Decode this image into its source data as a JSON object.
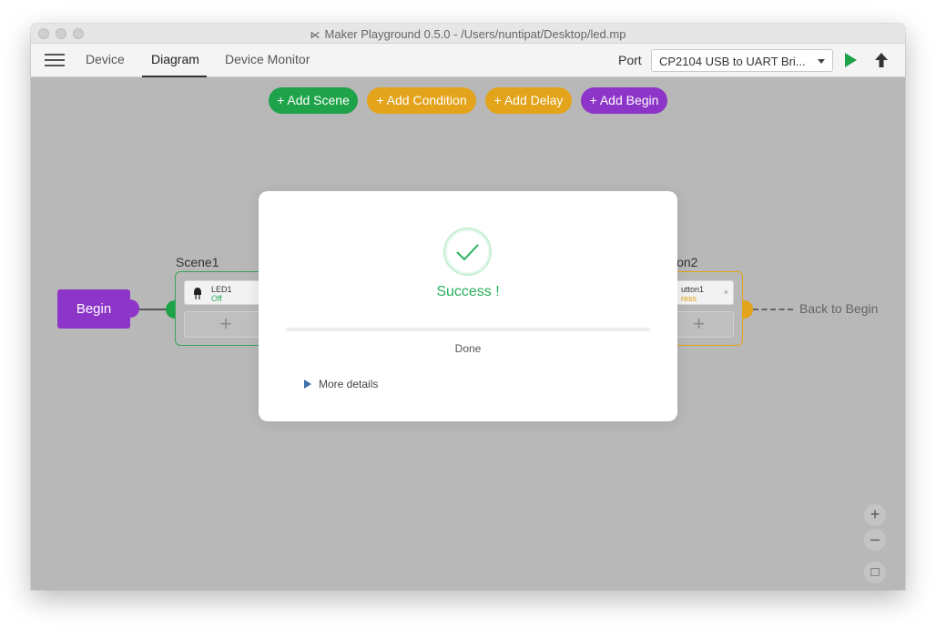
{
  "window": {
    "title": "Maker Playground 0.5.0 - /Users/nuntipat/Desktop/led.mp"
  },
  "toolbar": {
    "tabs": [
      {
        "label": "Device"
      },
      {
        "label": "Diagram",
        "active": true
      },
      {
        "label": "Device Monitor"
      }
    ],
    "port_label": "Port",
    "port_value": "CP2104 USB to UART Bri..."
  },
  "canvas": {
    "add_buttons": [
      {
        "label": "+ Add Scene",
        "color": "#1fa34a"
      },
      {
        "label": "+ Add Condition",
        "color": "#e3a31a"
      },
      {
        "label": "+ Add Delay",
        "color": "#e3a31a"
      },
      {
        "label": "+ Add Begin",
        "color": "#8d35c8"
      }
    ],
    "begin_label": "Begin",
    "scene": {
      "title": "Scene1",
      "device_name": "LED1",
      "device_status": "Off",
      "add_symbol": "+"
    },
    "condition": {
      "title": "ion2",
      "device_name": "utton1",
      "device_status": "ress",
      "close_symbol": "×",
      "add_symbol": "+"
    },
    "back_to_begin": "Back to Begin",
    "zoom": {
      "in": "+",
      "out": "–",
      "fit": "□"
    }
  },
  "dialog": {
    "title": "Success !",
    "progress_status": "Done",
    "progress_fraction": 1.0,
    "more_details": "More details",
    "colors": {
      "success": "#27b05a",
      "scene": "#1fa34a",
      "condition": "#e3a31a",
      "begin": "#8d35c8"
    }
  }
}
